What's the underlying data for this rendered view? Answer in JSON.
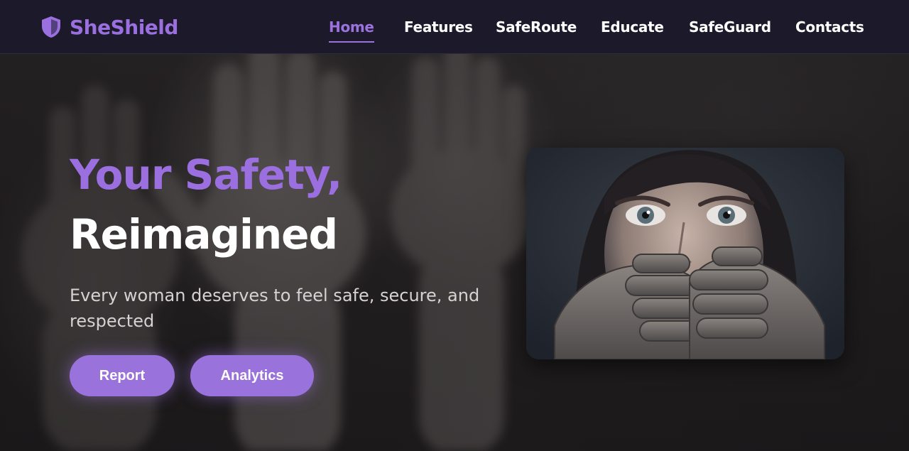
{
  "brand": {
    "name": "SheShield",
    "icon": "shield-icon",
    "color": "#9a6fe0"
  },
  "nav": {
    "items": [
      {
        "label": "Home",
        "active": true
      },
      {
        "label": "Features",
        "active": false
      },
      {
        "label": "SafeRoute",
        "active": false
      },
      {
        "label": "Educate",
        "active": false
      },
      {
        "label": "SafeGuard",
        "active": false
      },
      {
        "label": "Contacts",
        "active": false
      }
    ]
  },
  "hero": {
    "title_line1": "Your Safety,",
    "title_line2": "Reimagined",
    "subtitle": "Every woman deserves to feel safe, secure, and respected",
    "buttons": {
      "report": "Report",
      "analytics": "Analytics"
    },
    "image": "woman-covered-mouth-photo"
  },
  "colors": {
    "accent": "#9a72dc",
    "navbar": "#1c1a2a",
    "background": "#232021"
  }
}
